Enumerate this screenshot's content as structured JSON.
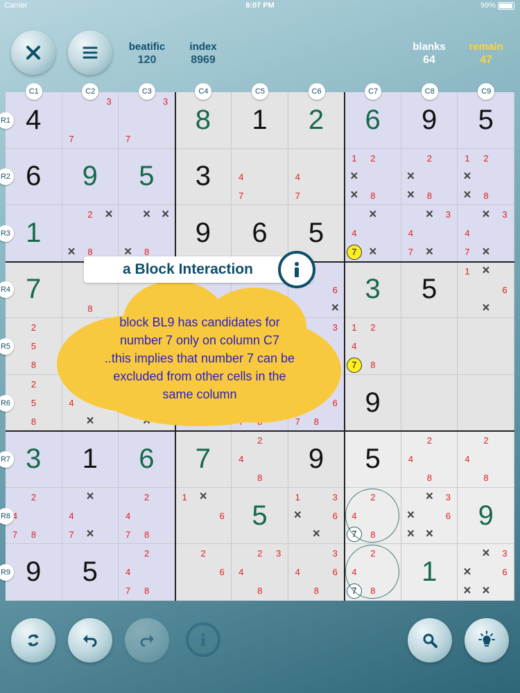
{
  "status": {
    "carrier": "Carrier",
    "time": "8:07 PM",
    "battery": "99%"
  },
  "header": {
    "beatific": {
      "label": "beatific",
      "value": "120"
    },
    "index": {
      "label": "index",
      "value": "8969"
    },
    "blanks": {
      "label": "blanks",
      "value": "64"
    },
    "remain": {
      "label": "remain",
      "value": "47"
    }
  },
  "columns": [
    "C1",
    "C2",
    "C3",
    "C4",
    "C5",
    "C6",
    "C7",
    "C8",
    "C9"
  ],
  "rows": [
    "R1",
    "R2",
    "R3",
    "R4",
    "R5",
    "R6",
    "R7",
    "R8",
    "R9"
  ],
  "popup": {
    "title": "a Block Interaction",
    "lines": [
      "block BL9 has candidates for",
      "number 7 only on column C7",
      "..this implies that number 7 can be",
      "excluded from other cells in the",
      "same column"
    ]
  },
  "icons": {
    "close": "close-x-icon",
    "menu": "hamburger-menu-icon",
    "refresh": "refresh-icon",
    "undo": "undo-icon",
    "redo": "redo-icon",
    "info": "info-icon",
    "search": "magnifier-icon",
    "hint": "lightbulb-icon"
  },
  "colors": {
    "accent": "#0d4e6b",
    "gold": "#ffd23a",
    "candidate": "#e02020",
    "user_digit": "#17694b"
  },
  "board": [
    [
      {
        "v": "4",
        "t": "g"
      },
      {
        "c": {
          "3": "3",
          "7": "7"
        }
      },
      {
        "c": {
          "3": "3",
          "7": "7"
        }
      },
      {
        "v": "8",
        "t": "u"
      },
      {
        "v": "1",
        "t": "g"
      },
      {
        "v": "2",
        "t": "u"
      },
      {
        "v": "6",
        "t": "u"
      },
      {
        "v": "9",
        "t": "g"
      },
      {
        "v": "5",
        "t": "g"
      }
    ],
    [
      {
        "v": "6",
        "t": "g"
      },
      {
        "v": "9",
        "t": "u"
      },
      {
        "v": "5",
        "t": "u"
      },
      {
        "v": "3",
        "t": "g"
      },
      {
        "c": {
          "4": "4",
          "7": "7"
        }
      },
      {
        "c": {
          "4": "4",
          "7": "7"
        }
      },
      {
        "c": {
          "1": "1",
          "2": "2",
          "4": "x",
          "7": "x",
          "8": "8"
        }
      },
      {
        "c": {
          "2": "2",
          "4": "x",
          "7": "x",
          "8": "8"
        }
      },
      {
        "c": {
          "1": "1",
          "2": "2",
          "4": "x",
          "7": "x",
          "8": "8"
        }
      }
    ],
    [
      {
        "v": "1",
        "t": "u"
      },
      {
        "c": {
          "2": "2",
          "3": "x",
          "7": "x",
          "8": "8"
        }
      },
      {
        "c": {
          "2": "x",
          "3": "x",
          "7": "x",
          "8": "8"
        }
      },
      {
        "v": "9",
        "t": "g"
      },
      {
        "v": "6",
        "t": "g"
      },
      {
        "v": "5",
        "t": "g"
      },
      {
        "c": {
          "2": "x",
          "4": "4",
          "7": "hi:7",
          "8": "x"
        }
      },
      {
        "c": {
          "2": "x",
          "3": "3",
          "4": "4",
          "7": "7",
          "8": "x"
        }
      },
      {
        "c": {
          "2": "x",
          "3": "3",
          "4": "4",
          "7": "7",
          "8": "x"
        }
      }
    ],
    [
      {
        "v": "7",
        "t": "u"
      },
      {
        "c": {
          "2": "2",
          "8": "8"
        }
      },
      {
        "c": {}
      },
      {
        "c": {}
      },
      {
        "c": {}
      },
      {
        "c": {
          "6": "6",
          "9": "x"
        }
      },
      {
        "v": "3",
        "t": "u"
      },
      {
        "v": "5",
        "t": "g"
      },
      {
        "c": {
          "1": "1",
          "2": "x",
          "6": "6",
          "8": "x"
        }
      }
    ],
    [
      {
        "c": {
          "2": "2",
          "5": "5",
          "8": "8"
        }
      },
      {
        "c": {}
      },
      {
        "c": {}
      },
      {
        "c": {}
      },
      {
        "c": {}
      },
      {
        "c": {
          "3": "3"
        }
      },
      {
        "c": {
          "1": "1",
          "2": "2",
          "4": "4",
          "7": "hi:7",
          "8": "8"
        }
      },
      {
        "c": {}
      },
      {
        "c": {}
      }
    ],
    [
      {
        "c": {
          "2": "2",
          "5": "5",
          "8": "8"
        }
      },
      {
        "c": {
          "4": "4",
          "8": "x"
        }
      },
      {
        "c": {
          "8": "x"
        }
      },
      {
        "c": {}
      },
      {
        "c": {
          "7": "7",
          "8": "8"
        }
      },
      {
        "c": {
          "6": "6",
          "7": "7",
          "8": "8"
        }
      },
      {
        "v": "9",
        "t": "g"
      },
      {
        "c": {}
      },
      {
        "c": {}
      }
    ],
    [
      {
        "v": "3",
        "t": "u"
      },
      {
        "v": "1",
        "t": "g"
      },
      {
        "v": "6",
        "t": "u"
      },
      {
        "v": "7",
        "t": "u"
      },
      {
        "c": {
          "2": "2",
          "4": "4",
          "8": "8"
        }
      },
      {
        "v": "9",
        "t": "g"
      },
      {
        "v": "5",
        "t": "g"
      },
      {
        "c": {
          "2": "2",
          "4": "4",
          "8": "8"
        }
      },
      {
        "c": {
          "2": "2",
          "4": "4",
          "8": "8"
        }
      }
    ],
    [
      {
        "c": {
          "2": "2",
          "4": "4",
          "7": "7",
          "8": "8"
        }
      },
      {
        "c": {
          "2": "x",
          "4": "4",
          "7": "7",
          "8": "x"
        }
      },
      {
        "c": {
          "2": "2",
          "4": "4",
          "7": "7",
          "8": "8"
        }
      },
      {
        "c": {
          "1": "1",
          "2": "x",
          "6": "6"
        }
      },
      {
        "v": "5",
        "t": "u"
      },
      {
        "c": {
          "1": "1",
          "3": "3",
          "4": "x",
          "6": "6",
          "8": "x"
        }
      },
      {
        "c": {
          "2": "2",
          "4": "4",
          "7": "ring:7",
          "8": "8"
        },
        "circle": true
      },
      {
        "c": {
          "2": "x",
          "3": "3",
          "4": "x",
          "6": "6",
          "7": "x",
          "8": "x"
        }
      },
      {
        "v": "9",
        "t": "u"
      }
    ],
    [
      {
        "v": "9",
        "t": "g"
      },
      {
        "v": "5",
        "t": "g"
      },
      {
        "c": {
          "2": "2",
          "4": "4",
          "7": "7",
          "8": "8"
        }
      },
      {
        "c": {
          "2": "2",
          "6": "6"
        }
      },
      {
        "c": {
          "2": "2",
          "3": "3",
          "4": "4",
          "8": "8"
        }
      },
      {
        "c": {
          "3": "3",
          "4": "4",
          "6": "6",
          "8": "8"
        }
      },
      {
        "c": {
          "2": "2",
          "4": "4",
          "7": "ring:7",
          "8": "8"
        },
        "circle": true
      },
      {
        "v": "1",
        "t": "u"
      },
      {
        "c": {
          "2": "x",
          "3": "3",
          "4": "x",
          "6": "6",
          "7": "x",
          "8": "x"
        }
      }
    ]
  ]
}
